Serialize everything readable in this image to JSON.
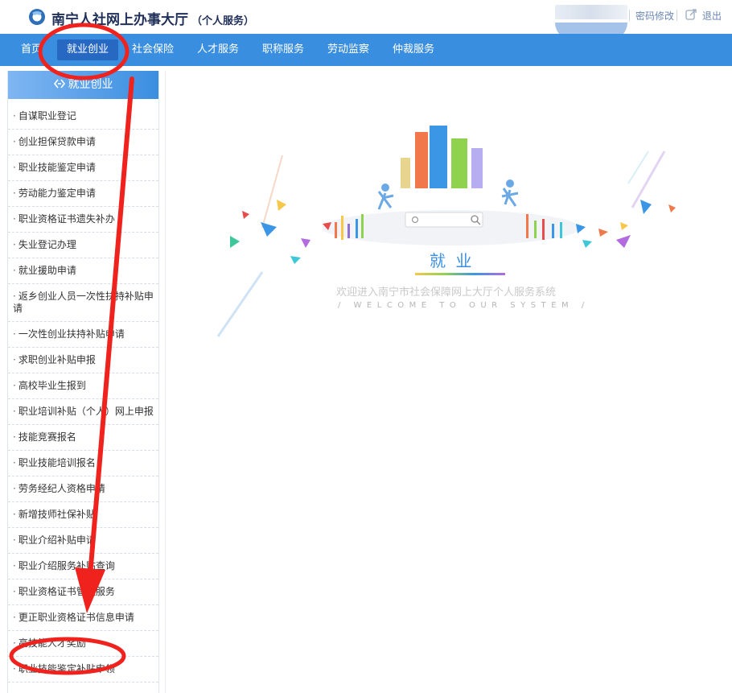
{
  "header": {
    "site_title": "南宁人社网上办事大厅",
    "site_subtitle": "（个人服务）",
    "change_password": "密码修改",
    "logout": "退出"
  },
  "nav": {
    "items": [
      {
        "label": "首页"
      },
      {
        "label": "就业创业"
      },
      {
        "label": "社会保险"
      },
      {
        "label": "人才服务"
      },
      {
        "label": "职称服务"
      },
      {
        "label": "劳动监察"
      },
      {
        "label": "仲裁服务"
      }
    ],
    "active_label": "就业创业"
  },
  "sidebar": {
    "title": "就业创业",
    "items": [
      {
        "label": "自谋职业登记"
      },
      {
        "label": "创业担保贷款申请"
      },
      {
        "label": "职业技能鉴定申请"
      },
      {
        "label": "劳动能力鉴定申请"
      },
      {
        "label": "职业资格证书遗失补办"
      },
      {
        "label": "失业登记办理"
      },
      {
        "label": "就业援助申请"
      },
      {
        "label": "返乡创业人员一次性扶持补贴申请"
      },
      {
        "label": "一次性创业扶持补贴申请"
      },
      {
        "label": "求职创业补贴申报"
      },
      {
        "label": "高校毕业生报到"
      },
      {
        "label": "职业培训补贴（个人）网上申报"
      },
      {
        "label": "技能竞赛报名"
      },
      {
        "label": "职业技能培训报名"
      },
      {
        "label": "劳务经纪人资格申请"
      },
      {
        "label": "新增技师社保补贴"
      },
      {
        "label": "职业介绍补贴申请"
      },
      {
        "label": "职业介绍服务补贴查询"
      },
      {
        "label": "职业资格证书管理服务"
      },
      {
        "label": "更正职业资格证书信息申请"
      },
      {
        "label": "高技能人才奖励"
      },
      {
        "label": "职业技能鉴定补贴申领"
      }
    ]
  },
  "main": {
    "title": "就 业",
    "welcome_text": "欢迎进入南宁市社会保障网上大厅个人服务系统",
    "welcome_en": "/ WELCOME TO OUR SYSTEM /"
  },
  "colors": {
    "nav_bg": "#3a8ee0",
    "nav_active": "#2668c2",
    "annotation_red": "#f0221e"
  }
}
